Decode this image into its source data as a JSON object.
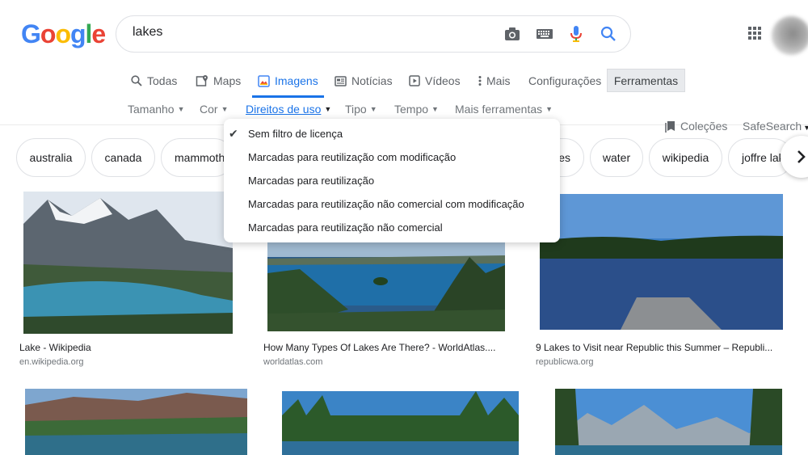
{
  "header": {
    "logo_letters": [
      "G",
      "o",
      "o",
      "g",
      "l",
      "e"
    ],
    "logo_colors": [
      "#4285f4",
      "#ea4335",
      "#fbbc05",
      "#4285f4",
      "#34a853",
      "#ea4335"
    ],
    "query": "lakes"
  },
  "tabs": [
    {
      "label": "Todas",
      "icon": "search-icon"
    },
    {
      "label": "Maps",
      "icon": "map-icon"
    },
    {
      "label": "Imagens",
      "icon": "image-icon"
    },
    {
      "label": "Notícias",
      "icon": "news-icon"
    },
    {
      "label": "Vídeos",
      "icon": "video-icon"
    },
    {
      "label": "Mais",
      "icon": "more-vert-icon"
    },
    {
      "label": "Configurações"
    },
    {
      "label": "Ferramentas"
    }
  ],
  "tools": [
    {
      "label": "Tamanho"
    },
    {
      "label": "Cor"
    },
    {
      "label": "Direitos de uso"
    },
    {
      "label": "Tipo"
    },
    {
      "label": "Tempo"
    },
    {
      "label": "Mais ferramentas"
    }
  ],
  "right_links": {
    "colecoes": "Coleções",
    "safesearch": "SafeSearch"
  },
  "chips": [
    "australia",
    "canada",
    "mammoth",
    "es",
    "water",
    "wikipedia",
    "joffre lak"
  ],
  "dropdown": {
    "items": [
      "Sem filtro de licença",
      "Marcadas para reutilização com modificação",
      "Marcadas para reutilização",
      "Marcadas para reutilização não comercial com modificação",
      "Marcadas para reutilização não comercial"
    ],
    "selected_index": 0
  },
  "results": [
    {
      "title": "Lake - Wikipedia",
      "source": "en.wikipedia.org"
    },
    {
      "title": "How Many Types Of Lakes Are There? - WorldAtlas....",
      "source": "worldatlas.com"
    },
    {
      "title": "9 Lakes to Visit near Republic this Summer – Republi...",
      "source": "republicwa.org"
    }
  ],
  "colors": {
    "accent": "#1a73e8",
    "muted": "#70757a",
    "border": "#dfe1e5"
  }
}
